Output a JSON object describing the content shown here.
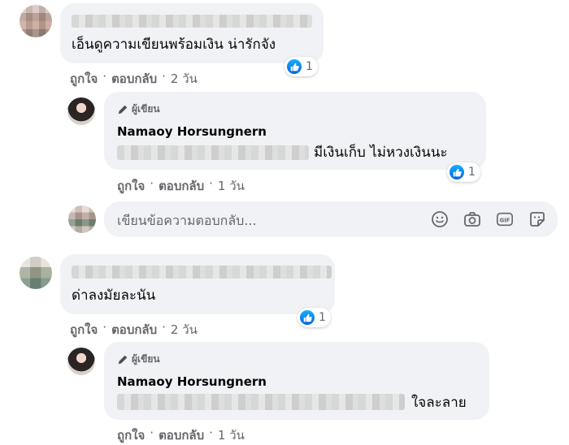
{
  "comments": [
    {
      "text": "เอ็นดูความเขียนพร้อมเงิน น่ารักจัง",
      "reaction_count": "1",
      "like": "ถูกใจ",
      "reply": "ตอบกลับ",
      "time": "2 วัน",
      "reply_item": {
        "badge": "ผู้เขียน",
        "name": "Namaoy Horsungnern",
        "text": "มีเงินเก็บ ไม่หวงเงินนะ",
        "reaction_count": "1",
        "like": "ถูกใจ",
        "reply": "ตอบกลับ",
        "time": "1 วัน"
      }
    },
    {
      "text": "ด่าลงมัยละนัน",
      "reaction_count": "1",
      "like": "ถูกใจ",
      "reply": "ตอบกลับ",
      "time": "2 วัน",
      "reply_item": {
        "badge": "ผู้เขียน",
        "name": "Namaoy Horsungnern",
        "text": "ใจละลาย",
        "like": "ถูกใจ",
        "reply": "ตอบกลับ",
        "time": "1 วัน"
      }
    }
  ],
  "reply_box": {
    "placeholder": "เขียนข้อความตอบกลับ..."
  },
  "separator": "·",
  "icons": [
    "pencil-icon",
    "like-icon",
    "emoji-icon",
    "camera-icon",
    "gif-icon",
    "sticker-icon"
  ],
  "colors": {
    "bubble": "#f0f2f5",
    "meta_text": "#65676b",
    "like_blue": "#1877f2"
  }
}
